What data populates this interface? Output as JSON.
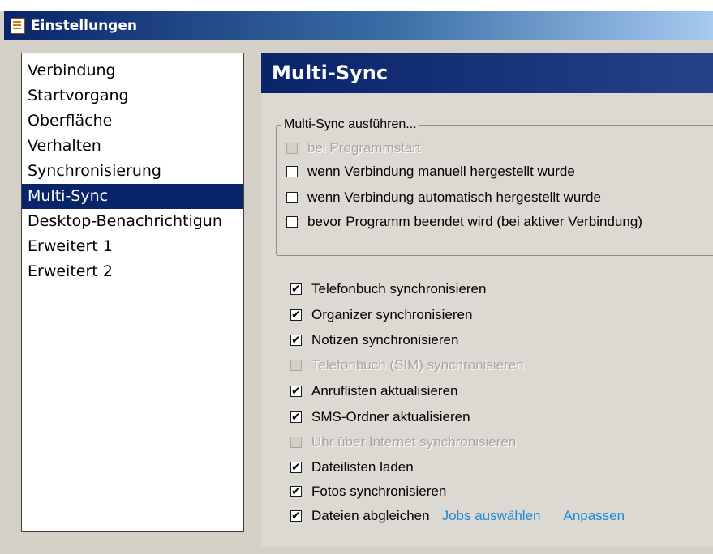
{
  "window": {
    "title": "Einstellungen",
    "icon": "settings-list-icon"
  },
  "sidebar": {
    "items": [
      {
        "label": "Verbindung",
        "active": false
      },
      {
        "label": "Startvorgang",
        "active": false
      },
      {
        "label": "Oberfläche",
        "active": false
      },
      {
        "label": "Verhalten",
        "active": false
      },
      {
        "label": "Synchronisierung",
        "active": false
      },
      {
        "label": "Multi-Sync",
        "active": true
      },
      {
        "label": "Desktop-Benachrichtigun",
        "active": false
      },
      {
        "label": "Erweitert 1",
        "active": false
      },
      {
        "label": "Erweitert 2",
        "active": false
      }
    ]
  },
  "panel": {
    "title": "Multi-Sync",
    "group": {
      "legend": "Multi-Sync ausführen...",
      "options": [
        {
          "label": "bei Programmstart",
          "checked": false,
          "disabled": true
        },
        {
          "label": "wenn Verbindung manuell hergestellt wurde",
          "checked": false,
          "disabled": false
        },
        {
          "label": "wenn Verbindung automatisch hergestellt wurde",
          "checked": false,
          "disabled": false
        },
        {
          "label": "bevor Programm beendet wird (bei aktiver Verbindung)",
          "checked": false,
          "disabled": false
        }
      ]
    },
    "sync_options": [
      {
        "label": "Telefonbuch synchronisieren",
        "checked": true,
        "disabled": false
      },
      {
        "label": "Organizer synchronisieren",
        "checked": true,
        "disabled": false
      },
      {
        "label": "Notizen synchronisieren",
        "checked": true,
        "disabled": false
      },
      {
        "label": "Telefonbuch (SIM) synchronisieren",
        "checked": false,
        "disabled": true
      },
      {
        "label": "Anruflisten aktualisieren",
        "checked": true,
        "disabled": false
      },
      {
        "label": "SMS-Ordner aktualisieren",
        "checked": true,
        "disabled": false
      },
      {
        "label": "Uhr über Internet synchronisieren",
        "checked": false,
        "disabled": true
      },
      {
        "label": "Dateilisten laden",
        "checked": true,
        "disabled": false
      },
      {
        "label": "Fotos synchronisieren",
        "checked": true,
        "disabled": false
      },
      {
        "label": "Dateien abgleichen",
        "checked": true,
        "disabled": false
      }
    ],
    "links": {
      "jobs": "Jobs auswählen",
      "customize": "Anpassen"
    }
  },
  "colors": {
    "selection": "#0a246a",
    "link": "#1e88d8",
    "disabled_text": "#a7a5a0",
    "window_bg": "#d4d0c8"
  }
}
